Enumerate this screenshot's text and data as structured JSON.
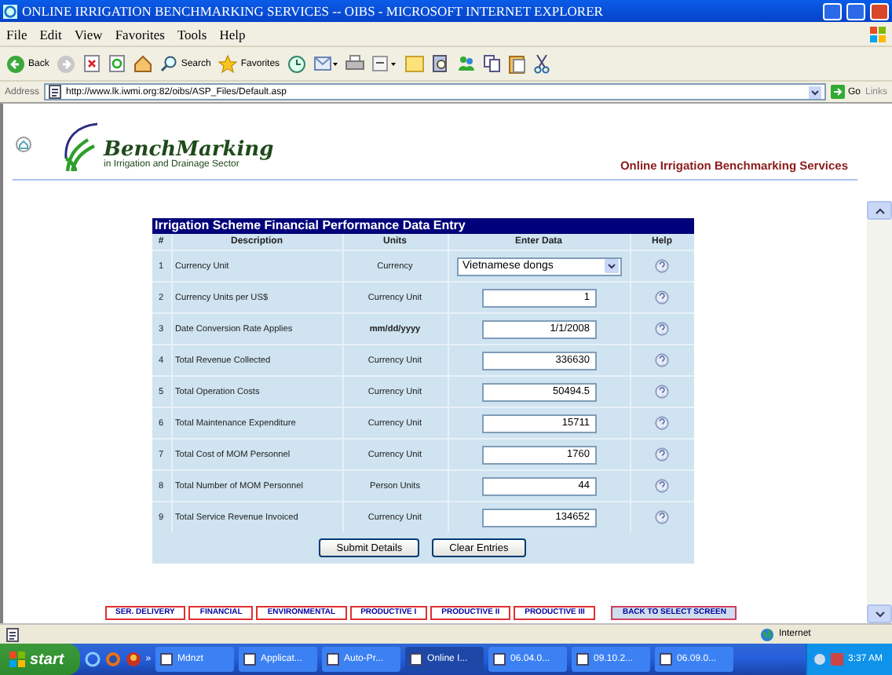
{
  "window": {
    "title": "ONLINE IRRIGATION BENCHMARKING SERVICES -- OIBS - MICROSOFT INTERNET EXPLORER"
  },
  "menu": [
    "File",
    "Edit",
    "View",
    "Favorites",
    "Tools",
    "Help"
  ],
  "toolbar": {
    "back": "Back",
    "search": "Search",
    "favorites": "Favorites"
  },
  "address": {
    "label": "Address",
    "url": "http://www.lk.iwmi.org:82/oibs/ASP_Files/Default.asp",
    "go": "Go",
    "links": "Links"
  },
  "page": {
    "logo_title": "BenchMarking",
    "logo_subtitle": "in Irrigation and Drainage Sector",
    "tagline": "Online Irrigation Benchmarking Services",
    "form": {
      "title": "Irrigation Scheme Financial Performance Data Entry",
      "columns": [
        "#",
        "Description",
        "Units",
        "Enter Data",
        "Help"
      ],
      "rows": [
        {
          "n": "1",
          "description": "Currency Unit",
          "units": "Currency",
          "emphasis": false,
          "kind": "select",
          "value": "Vietnamese dongs"
        },
        {
          "n": "2",
          "description": "Currency Units per US$",
          "units": "Currency Unit",
          "emphasis": false,
          "kind": "input",
          "value": "1"
        },
        {
          "n": "3",
          "description": "Date Conversion Rate Applies",
          "units": "mm/dd/yyyy",
          "emphasis": true,
          "kind": "input",
          "value": "1/1/2008"
        },
        {
          "n": "4",
          "description": "Total Revenue Collected",
          "units": "Currency Unit",
          "emphasis": false,
          "kind": "input",
          "value": "336630"
        },
        {
          "n": "5",
          "description": "Total Operation Costs",
          "units": "Currency Unit",
          "emphasis": false,
          "kind": "input",
          "value": "50494.5"
        },
        {
          "n": "6",
          "description": "Total Maintenance Expenditure",
          "units": "Currency Unit",
          "emphasis": false,
          "kind": "input",
          "value": "15711"
        },
        {
          "n": "7",
          "description": "Total Cost of MOM Personnel",
          "units": "Currency Unit",
          "emphasis": false,
          "kind": "input",
          "value": "1760"
        },
        {
          "n": "8",
          "description": "Total Number of MOM Personnel",
          "units": "Person Units",
          "emphasis": false,
          "kind": "input",
          "value": "44"
        },
        {
          "n": "9",
          "description": "Total Service Revenue Invoiced",
          "units": "Currency Unit",
          "emphasis": false,
          "kind": "input",
          "value": "134652"
        }
      ],
      "buttons": [
        "Submit Details",
        "Clear Entries"
      ]
    },
    "nav": [
      {
        "label": "SER. DELIVERY",
        "kind": "section"
      },
      {
        "label": "FINANCIAL",
        "kind": "section"
      },
      {
        "label": "ENVIRONMENTAL",
        "kind": "section"
      },
      {
        "label": "PRODUCTIVE I",
        "kind": "section"
      },
      {
        "label": "PRODUCTIVE II",
        "kind": "section"
      },
      {
        "label": "PRODUCTIVE III",
        "kind": "section"
      },
      {
        "label": "BACK TO SELECT SCREEN",
        "kind": "back"
      }
    ]
  },
  "status_bar": {
    "zone": "Internet"
  },
  "taskbar": {
    "start": "start",
    "chevron": "»",
    "tasks": [
      {
        "label": "Mdnzt",
        "selected": false
      },
      {
        "label": "Applicat...",
        "selected": false
      },
      {
        "label": "Auto-Pr...",
        "selected": false
      },
      {
        "label": "Online I...",
        "selected": true
      },
      {
        "label": "06.04.0...",
        "selected": false
      },
      {
        "label": "09.10.2...",
        "selected": false
      },
      {
        "label": "06.09.0...",
        "selected": false
      }
    ],
    "clock": "3:37 AM"
  }
}
